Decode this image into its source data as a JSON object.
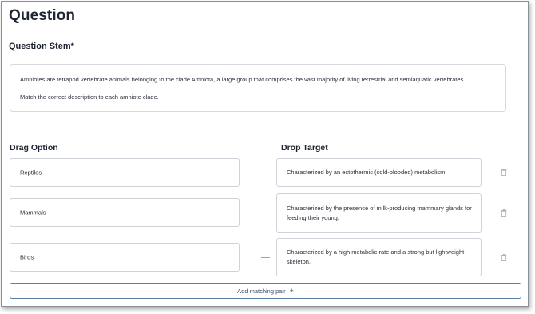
{
  "page_title": "Question",
  "stem": {
    "label": "Question Stem*",
    "paragraph_1": "Amniotes are tetrapod vertebrate animals belonging to the clade Amniota, a large group that comprises the vast majority of living terrestrial and semiaquatic vertebrates.",
    "paragraph_2": "Match the correct description to each amniote clade."
  },
  "columns": {
    "drag_heading": "Drag Option",
    "drop_heading": "Drop Target"
  },
  "pairs": [
    {
      "option": "Reptiles",
      "target": "Characterized by an ectothermic (cold-blooded) metabolism."
    },
    {
      "option": "Mammals",
      "target": "Characterized by the presence of milk-producing mammary glands for feeding their young."
    },
    {
      "option": "Birds",
      "target": "Characterized by a high metabolic rate and a strong but lightweight skeleton."
    }
  ],
  "add_pair": {
    "label": "Add matching pair",
    "icon": "plus-icon"
  },
  "colors": {
    "border": "#cfd2d8",
    "button_border": "#5b7fa3",
    "text": "#1f2433"
  }
}
